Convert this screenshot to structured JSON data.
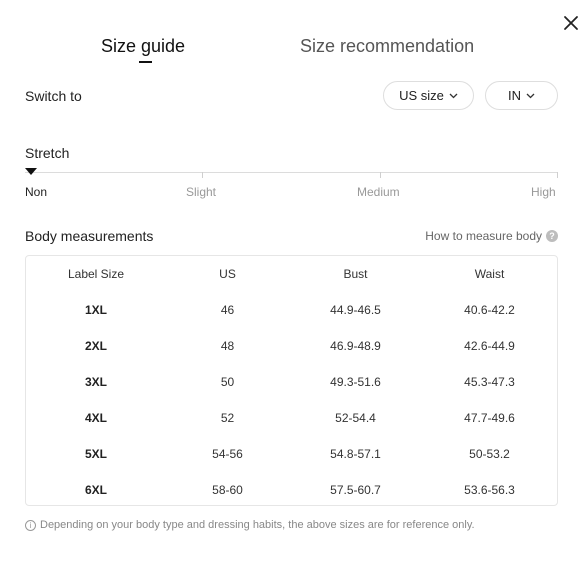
{
  "tabs": {
    "active": "Size guide",
    "inactive": "Size recommendation"
  },
  "switch": {
    "label": "Switch to",
    "size_option": "US size",
    "unit_option": "IN"
  },
  "stretch": {
    "label": "Stretch",
    "levels": [
      "Non",
      "Slight",
      "Medium",
      "High"
    ],
    "selected": "Non"
  },
  "body_measurements": {
    "label": "Body measurements",
    "how_to": "How to measure body"
  },
  "table": {
    "headers": [
      "Label Size",
      "US",
      "Bust",
      "Waist"
    ],
    "rows": [
      [
        "1XL",
        "46",
        "44.9-46.5",
        "40.6-42.2"
      ],
      [
        "2XL",
        "48",
        "46.9-48.9",
        "42.6-44.9"
      ],
      [
        "3XL",
        "50",
        "49.3-51.6",
        "45.3-47.3"
      ],
      [
        "4XL",
        "52",
        "52-54.4",
        "47.7-49.6"
      ],
      [
        "5XL",
        "54-56",
        "54.8-57.1",
        "50-53.2"
      ],
      [
        "6XL",
        "58-60",
        "57.5-60.7",
        "53.6-56.3"
      ]
    ]
  },
  "note": "Depending on your body type and dressing habits, the above sizes are for reference only.",
  "icons": {
    "close": "close-icon",
    "chevron": "chevron-down-icon",
    "help": "question-circle-icon",
    "info": "info-icon"
  }
}
